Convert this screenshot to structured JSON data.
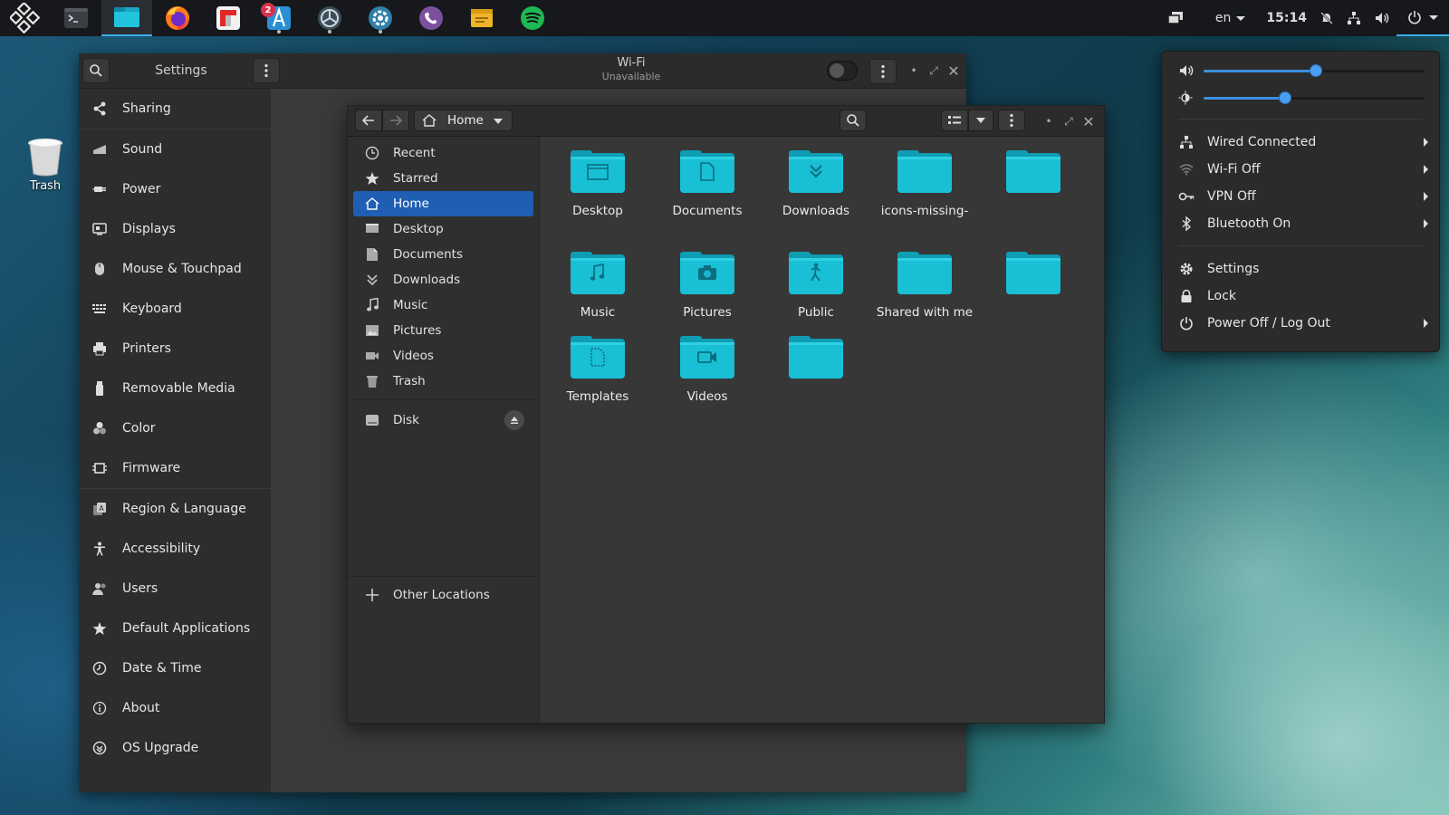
{
  "desktop": {
    "trash_label": "Trash"
  },
  "topbar": {
    "apps": [
      {
        "name": "terminal-icon"
      },
      {
        "name": "files-icon",
        "active": true
      },
      {
        "name": "firefox-icon"
      },
      {
        "name": "flipboard-icon"
      },
      {
        "name": "app-center-icon",
        "badge": "2"
      },
      {
        "name": "pantheon-tweaks-icon"
      },
      {
        "name": "system-settings-icon"
      },
      {
        "name": "viber-icon"
      },
      {
        "name": "notes-icon"
      },
      {
        "name": "spotify-icon"
      }
    ],
    "language": "en",
    "clock": "15:14"
  },
  "settings": {
    "title": "Settings",
    "header": {
      "wifi_title": "Wi-Fi",
      "wifi_status": "Unavailable"
    },
    "sidebar": [
      {
        "label": "Sharing",
        "icon": "share-icon"
      },
      {
        "label": "Sound",
        "icon": "speaker-icon"
      },
      {
        "label": "Power",
        "icon": "power-plug-icon"
      },
      {
        "label": "Displays",
        "icon": "display-icon"
      },
      {
        "label": "Mouse & Touchpad",
        "icon": "mouse-icon"
      },
      {
        "label": "Keyboard",
        "icon": "keyboard-icon"
      },
      {
        "label": "Printers",
        "icon": "printer-icon"
      },
      {
        "label": "Removable Media",
        "icon": "usb-icon"
      },
      {
        "label": "Color",
        "icon": "color-icon"
      },
      {
        "label": "Firmware",
        "icon": "chip-icon"
      },
      {
        "label": "Region & Language",
        "icon": "language-icon"
      },
      {
        "label": "Accessibility",
        "icon": "accessibility-icon"
      },
      {
        "label": "Users",
        "icon": "users-icon"
      },
      {
        "label": "Default Applications",
        "icon": "star-icon"
      },
      {
        "label": "Date & Time",
        "icon": "clock-icon"
      },
      {
        "label": "About",
        "icon": "info-icon"
      },
      {
        "label": "OS Upgrade",
        "icon": "upgrade-icon"
      }
    ]
  },
  "files": {
    "location": "Home",
    "places": [
      {
        "label": "Recent",
        "icon": "recent-icon"
      },
      {
        "label": "Starred",
        "icon": "star-icon"
      },
      {
        "label": "Home",
        "icon": "home-icon",
        "selected": true
      },
      {
        "label": "Desktop",
        "icon": "desktop-icon"
      },
      {
        "label": "Documents",
        "icon": "document-icon"
      },
      {
        "label": "Downloads",
        "icon": "download-icon"
      },
      {
        "label": "Music",
        "icon": "music-icon"
      },
      {
        "label": "Pictures",
        "icon": "picture-icon"
      },
      {
        "label": "Videos",
        "icon": "video-icon"
      },
      {
        "label": "Trash",
        "icon": "trash-icon"
      }
    ],
    "devices": [
      {
        "label": "Disk",
        "icon": "disk-icon"
      }
    ],
    "other_locations": "Other Locations",
    "folders": [
      {
        "label": "Desktop",
        "glyph": "desktop"
      },
      {
        "label": "Documents",
        "glyph": "document"
      },
      {
        "label": "Downloads",
        "glyph": "download"
      },
      {
        "label": "icons-missing-",
        "glyph": ""
      },
      {
        "label": "",
        "glyph": ""
      },
      {
        "label": "Music",
        "glyph": "music"
      },
      {
        "label": "Pictures",
        "glyph": "camera"
      },
      {
        "label": "Public",
        "glyph": "person"
      },
      {
        "label": "Shared with me",
        "glyph": ""
      },
      {
        "label": "",
        "glyph": ""
      },
      {
        "label": "Templates",
        "glyph": "template"
      },
      {
        "label": "Videos",
        "glyph": "video"
      },
      {
        "label": "",
        "glyph": ""
      }
    ]
  },
  "system_menu": {
    "volume_level": 0.51,
    "brightness_level": 0.37,
    "items": [
      {
        "label": "Wired Connected",
        "icon": "network-wired-icon",
        "submenu": true
      },
      {
        "label": "Wi-Fi Off",
        "icon": "wifi-icon",
        "submenu": true
      },
      {
        "label": "VPN Off",
        "icon": "vpn-key-icon",
        "submenu": true
      },
      {
        "label": "Bluetooth On",
        "icon": "bluetooth-icon",
        "submenu": true
      },
      {
        "label": "Settings",
        "icon": "gear-icon",
        "submenu": false
      },
      {
        "label": "Lock",
        "icon": "lock-icon",
        "submenu": false
      },
      {
        "label": "Power Off / Log Out",
        "icon": "power-icon",
        "submenu": true
      }
    ]
  },
  "colors": {
    "accent": "#3daee9",
    "selection": "#1f5eb3",
    "folder": "#16b8cf",
    "slider": "#3d8fe0"
  }
}
